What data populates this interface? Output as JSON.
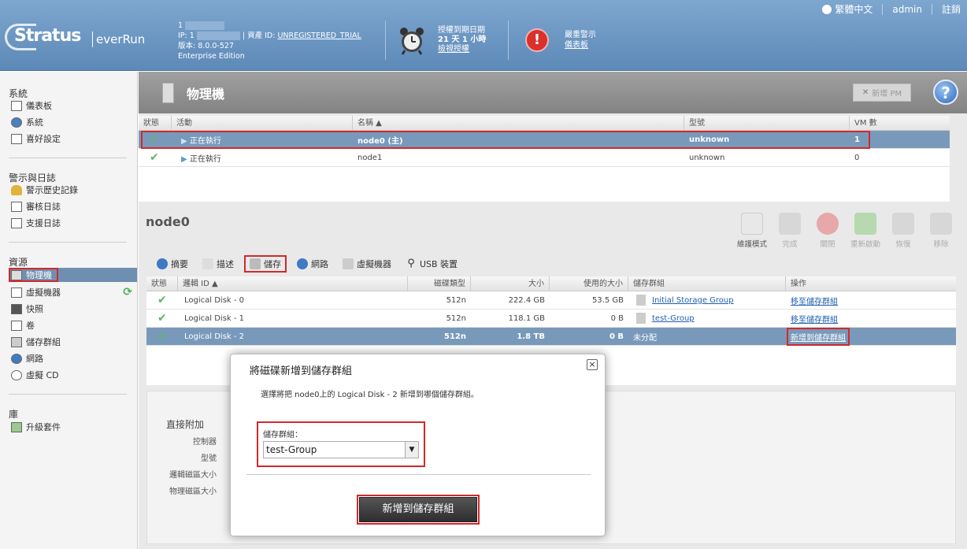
{
  "header": {
    "logo_main": "Stratus",
    "logo_sub": "everRun",
    "system_name_prefix": "1",
    "ip_label": "IP: 1",
    "asset_id_label": "| 資產 ID:",
    "asset_id_value": "UNREGISTERED_TRIAL",
    "version": "版本: 8.0.0-527",
    "edition": "Enterprise Edition",
    "license_title": "授權到期日期",
    "license_remaining": "21 天 1 小時",
    "license_link": "檢視授權",
    "alarm_title": "嚴重警示",
    "alarm_link": "儀表板",
    "language": "繁體中文",
    "user": "admin",
    "logout": "註銷"
  },
  "sidebar": {
    "groups": [
      {
        "label": "系統",
        "items": [
          "儀表板",
          "系統",
          "喜好設定"
        ]
      },
      {
        "label": "警示與日誌",
        "items": [
          "警示歷史記錄",
          "審核日誌",
          "支援日誌"
        ]
      },
      {
        "label": "資源",
        "items": [
          "物理機",
          "虛擬機器",
          "快照",
          "卷",
          "儲存群組",
          "網路",
          "虛擬 CD"
        ]
      },
      {
        "label": "庫",
        "items": [
          "升級套件"
        ]
      }
    ]
  },
  "page": {
    "title": "物理機",
    "new_pm_button": "新增 PM",
    "help_symbol": "?"
  },
  "pm_table": {
    "headers": [
      "狀態",
      "活動",
      "名稱 ▲",
      "型號",
      "VM 數"
    ],
    "rows": [
      {
        "activity": "正在執行",
        "name": "node0 (主)",
        "model": "unknown",
        "vms": "1"
      },
      {
        "activity": "正在執行",
        "name": "node1",
        "model": "unknown",
        "vms": "0"
      }
    ]
  },
  "node": {
    "title": "node0",
    "actions": [
      "維護模式",
      "完成",
      "關閉",
      "重新啟動",
      "恢復",
      "移除"
    ],
    "tabs": [
      "摘要",
      "描述",
      "儲存",
      "網路",
      "虛擬機器",
      "USB 裝置"
    ]
  },
  "disk_table": {
    "headers": [
      "狀態",
      "邏輯 ID ▲",
      "磁碟類型",
      "大小",
      "使用的大小",
      "儲存群組",
      "操作"
    ],
    "rows": [
      {
        "id": "Logical Disk - 0",
        "type": "512n",
        "size": "222.4 GB",
        "used": "53.5 GB",
        "group": "Initial Storage Group",
        "action": "移至儲存群組"
      },
      {
        "id": "Logical Disk - 1",
        "type": "512n",
        "size": "118.1 GB",
        "used": "0 B",
        "group": "test-Group",
        "action": "移至儲存群組"
      },
      {
        "id": "Logical Disk - 2",
        "type": "512n",
        "size": "1.8 TB",
        "used": "0 B",
        "group": "未分配",
        "action": "新增到儲存群組"
      }
    ]
  },
  "detail": {
    "title": "直接附加",
    "labels": [
      "控制器",
      "型號",
      "邏輯磁區大小",
      "物理磁區大小"
    ]
  },
  "modal": {
    "title": "將磁碟新增到儲存群組",
    "description": "選擇將把 node0上的 Logical Disk - 2 新增到哪個儲存群組。",
    "group_label": "儲存群組：",
    "selected_group": "test-Group",
    "submit_button": "新增到儲存群組",
    "close_symbol": "×"
  }
}
